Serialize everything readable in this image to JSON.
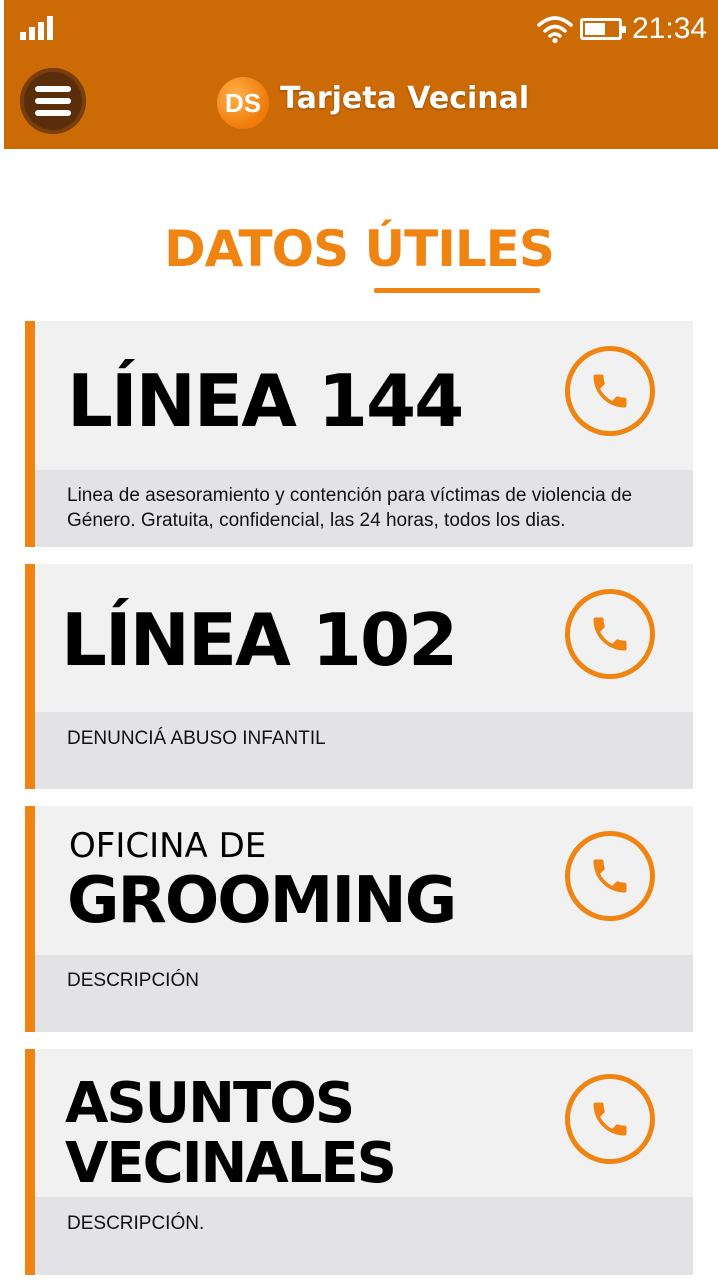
{
  "status_bar": {
    "time": "21:34"
  },
  "header": {
    "logo_text": "DS",
    "app_name": "Tarjeta Vecinal",
    "bg_color": "#cc6a06"
  },
  "page": {
    "title": "DATOS ÚTILES",
    "accent_color": "#ef8412"
  },
  "cards": [
    {
      "title": "LÍNEA 144",
      "description": "Linea de asesoramiento y contención para víctimas de violencia de Género. Gratuita, confidencial, las 24 horas, todos los dias."
    },
    {
      "title": "LÍNEA 102",
      "description": "DENUNCIÁ ABUSO INFANTIL"
    },
    {
      "subtitle": "OFICINA DE",
      "title": "GROOMING",
      "description": "DESCRIPCIÓN"
    },
    {
      "title_line1": "ASUNTOS",
      "title_line2": "VECINALES",
      "description": "DESCRIPCIÓN."
    }
  ],
  "icons": {
    "menu": "hamburger-icon",
    "call": "phone-icon",
    "signal": "signal-icon",
    "wifi": "wifi-icon",
    "battery": "battery-icon"
  }
}
